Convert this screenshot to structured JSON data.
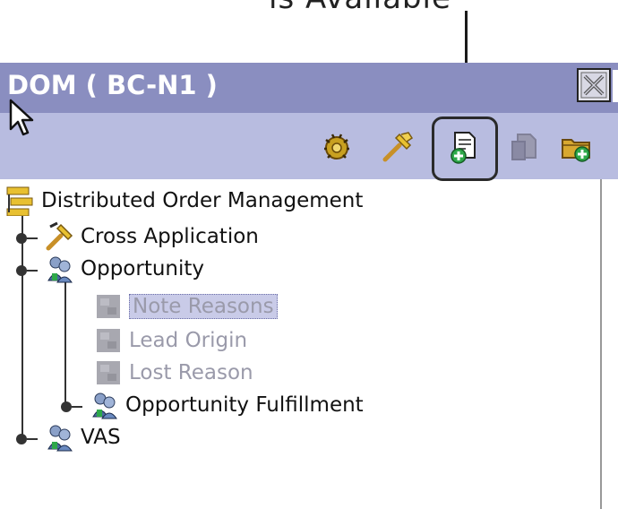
{
  "callout": {
    "text": "is Available"
  },
  "panel": {
    "title": "DOM ( BC-N1 )"
  },
  "toolbar": {
    "buttons": [
      {
        "icon": "gear-bug-icon"
      },
      {
        "icon": "hammer-icon"
      },
      {
        "icon": "add-document-icon"
      },
      {
        "icon": "document-disabled-icon"
      },
      {
        "icon": "add-folder-icon"
      }
    ]
  },
  "tree": {
    "root": {
      "label": "Distributed Order Management",
      "icon": "hierarchy-icon"
    },
    "items": [
      {
        "label": "Cross Application",
        "icon": "hammer-icon"
      },
      {
        "label": "Opportunity",
        "icon": "people-icon"
      },
      {
        "label": "Note Reasons",
        "icon": "gray-block-icon",
        "selected": true
      },
      {
        "label": "Lead Origin",
        "icon": "gray-block-icon"
      },
      {
        "label": "Lost Reason",
        "icon": "gray-block-icon"
      },
      {
        "label": "Opportunity Fulfillment",
        "icon": "people-icon"
      },
      {
        "label": "VAS",
        "icon": "people-icon"
      }
    ]
  },
  "colors": {
    "titlebar": "#8a8ec0",
    "toolbar": "#b8bce0",
    "selection": "#c9cbe8"
  }
}
